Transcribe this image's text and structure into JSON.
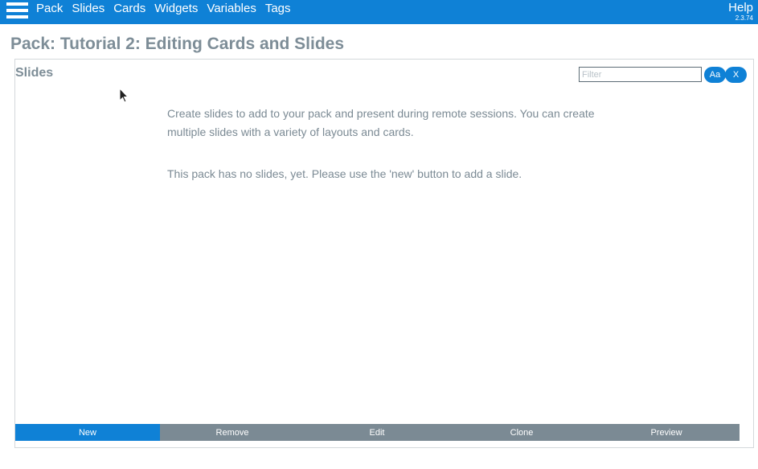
{
  "topbar": {
    "menu": [
      "Pack",
      "Slides",
      "Cards",
      "Widgets",
      "Variables",
      "Tags"
    ],
    "help_label": "Help",
    "version": "2.3.74"
  },
  "page": {
    "title": "Pack: Tutorial 2: Editing Cards and Slides"
  },
  "panel": {
    "title": "Slides",
    "filter_placeholder": "Filter",
    "aa_label": "Aa",
    "clear_label": "X",
    "message_line1": "Create slides to add to your pack and present during remote sessions. You can create multiple slides with a variety of layouts and cards.",
    "message_line2": "This pack has no slides, yet. Please use the 'new' button to add a slide."
  },
  "toolbar": {
    "buttons": [
      "New",
      "Remove",
      "Edit",
      "Clone",
      "Preview"
    ],
    "active": "New"
  },
  "colors": {
    "accent": "#0f81d6",
    "toolbar": "#7b8a94",
    "text": "#7b8a94"
  }
}
